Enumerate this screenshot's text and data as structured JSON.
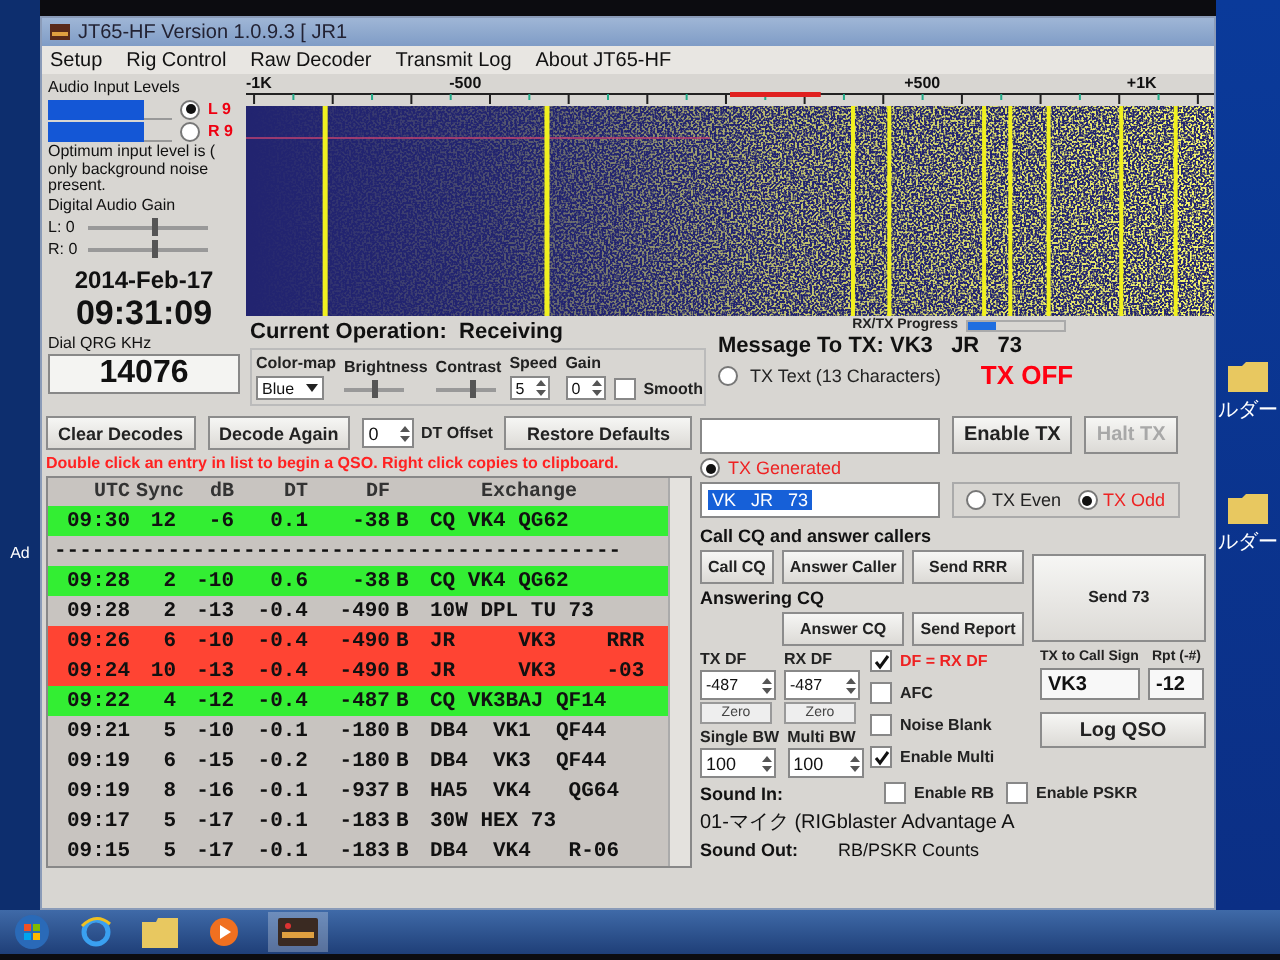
{
  "window": {
    "title": "JT65-HF Version 1.0.9.3 [ JR1"
  },
  "menu": [
    "Setup",
    "Rig Control",
    "Raw Decoder",
    "Transmit Log",
    "About JT65-HF"
  ],
  "audio": {
    "title": "Audio Input Levels",
    "note": "Optimum input level is ( only background noise present.",
    "channels": [
      {
        "label": "L 9",
        "level": 0.78,
        "selected": true
      },
      {
        "label": "R 9",
        "level": 0.78,
        "selected": false
      }
    ]
  },
  "gain": {
    "title": "Digital Audio Gain",
    "sliders": [
      {
        "label": "L: 0",
        "level": 0.55
      },
      {
        "label": "R: 0",
        "level": 0.55
      }
    ]
  },
  "date": "2014-Feb-17",
  "time": "09:31:09",
  "dial": {
    "label": "Dial QRG KHz",
    "value": "14076"
  },
  "waterfall": {
    "scale": [
      "-1K",
      "-500",
      "+500",
      "+1K"
    ]
  },
  "operation": {
    "label": "Current Operation:",
    "value": "Receiving"
  },
  "display": {
    "colormap": {
      "label": "Color-map",
      "value": "Blue"
    },
    "brightness": {
      "label": "Brightness",
      "level": 0.5
    },
    "contrast": {
      "label": "Contrast",
      "level": 0.6
    },
    "speed": {
      "label": "Speed",
      "value": "5"
    },
    "gain": {
      "label": "Gain",
      "value": "0"
    },
    "smooth": {
      "label": "Smooth",
      "checked": false
    }
  },
  "decoder": {
    "buttons": [
      "Clear Decodes",
      "Decode Again"
    ],
    "dt_offset": {
      "value": "0",
      "label": "DT Offset"
    },
    "restore": "Restore Defaults",
    "hint": "Double click an entry in list to begin a QSO.  Right click copies to clipboard."
  },
  "decodes": {
    "columns": [
      "UTC",
      "Sync",
      "dB",
      "DT",
      "DF",
      "Exchange"
    ],
    "rows": [
      {
        "kind": "decode",
        "color": "#33ee33",
        "cells": [
          "09:30",
          "12",
          "-6",
          "0.1",
          "-38",
          "B",
          "CQ VK4 QG62"
        ]
      },
      {
        "kind": "separator",
        "color": "#c8c4c0",
        "text": "---------------------------------------------"
      },
      {
        "kind": "decode",
        "color": "#33ee33",
        "cells": [
          "09:28",
          "2",
          "-10",
          "0.6",
          "-38",
          "B",
          "CQ VK4 QG62"
        ]
      },
      {
        "kind": "decode",
        "color": "#c8c4c0",
        "cells": [
          "09:28",
          "2",
          "-13",
          "-0.4",
          "-490",
          "B",
          "10W DPL TU 73"
        ]
      },
      {
        "kind": "decode",
        "color": "#ff4433",
        "cells": [
          "09:26",
          "6",
          "-10",
          "-0.4",
          "-490",
          "B",
          "JR     VK3    RRR"
        ]
      },
      {
        "kind": "decode",
        "color": "#ff4433",
        "cells": [
          "09:24",
          "10",
          "-13",
          "-0.4",
          "-490",
          "B",
          "JR     VK3    -03"
        ]
      },
      {
        "kind": "decode",
        "color": "#33ee33",
        "cells": [
          "09:22",
          "4",
          "-12",
          "-0.4",
          "-487",
          "B",
          "CQ VK3BAJ QF14"
        ]
      },
      {
        "kind": "decode",
        "color": "#c8c4c0",
        "cells": [
          "09:21",
          "5",
          "-10",
          "-0.1",
          "-180",
          "B",
          "DB4  VK1  QF44"
        ]
      },
      {
        "kind": "decode",
        "color": "#c8c4c0",
        "cells": [
          "09:19",
          "6",
          "-15",
          "-0.2",
          "-180",
          "B",
          "DB4  VK3  QF44"
        ]
      },
      {
        "kind": "decode",
        "color": "#c8c4c0",
        "cells": [
          "09:19",
          "8",
          "-16",
          "-0.1",
          "-937",
          "B",
          "HA5  VK4   QG64"
        ]
      },
      {
        "kind": "decode",
        "color": "#c8c4c0",
        "cells": [
          "09:17",
          "5",
          "-17",
          "-0.1",
          "-183",
          "B",
          "30W HEX 73"
        ]
      },
      {
        "kind": "decode",
        "color": "#c8c4c0",
        "cells": [
          "09:15",
          "5",
          "-17",
          "-0.1",
          "-183",
          "B",
          "DB4  VK4   R-06"
        ]
      }
    ]
  },
  "tx": {
    "progress": {
      "label": "RX/TX Progress",
      "level": 0.3
    },
    "message": {
      "label": "Message To TX:",
      "value": "VK3   JR   73"
    },
    "status": "TX OFF",
    "modes": [
      {
        "label": "TX Text (13 Characters)",
        "selected": false
      },
      {
        "label": "TX Generated",
        "selected": true
      }
    ],
    "generated": "VK   JR   73",
    "enable": {
      "label": "Enable TX",
      "disabled": false
    },
    "halt": {
      "label": "Halt TX",
      "disabled": true
    },
    "periods": [
      {
        "label": "TX Even",
        "selected": false
      },
      {
        "label": "TX Odd",
        "selected": true
      }
    ]
  },
  "callers": {
    "title": "Call CQ and answer callers",
    "buttons": [
      "Call CQ",
      "Answer Caller",
      "Send RRR"
    ],
    "answering": "Answering CQ",
    "answer_buttons": [
      "Answer CQ",
      "Send Report"
    ],
    "send73": "Send 73"
  },
  "frequencies": {
    "tx_df": {
      "label": "TX DF",
      "value": "-487",
      "zero": "Zero"
    },
    "rx_df": {
      "label": "RX DF",
      "value": "-487",
      "zero": "Zero"
    },
    "single_bw": {
      "label": "Single BW",
      "value": "100"
    },
    "multi_bw": {
      "label": "Multi BW",
      "value": "100"
    }
  },
  "options": {
    "df_lock": {
      "label": "DF = RX DF",
      "checked": true
    },
    "afc": {
      "label": "AFC",
      "checked": false
    },
    "noise_blank": {
      "label": "Noise Blank",
      "checked": false
    },
    "multi": {
      "label": "Enable Multi",
      "checked": true
    },
    "rb": {
      "label": "Enable RB",
      "checked": false
    },
    "pskr": {
      "label": "Enable PSKR",
      "checked": false
    }
  },
  "callsign": {
    "label": "TX to Call Sign",
    "value": "VK3",
    "rpt_label": "Rpt (-#)",
    "rpt": "-12",
    "log": "Log QSO"
  },
  "sound": {
    "in_label": "Sound In:",
    "in_device": "01-マイク (RIGblaster Advantage A",
    "counts": "RB/PSKR Counts",
    "out_label": "Sound Out:"
  },
  "desktop": {
    "left_label": "Ad",
    "icons": [
      "ルダー",
      "ルダー"
    ]
  }
}
